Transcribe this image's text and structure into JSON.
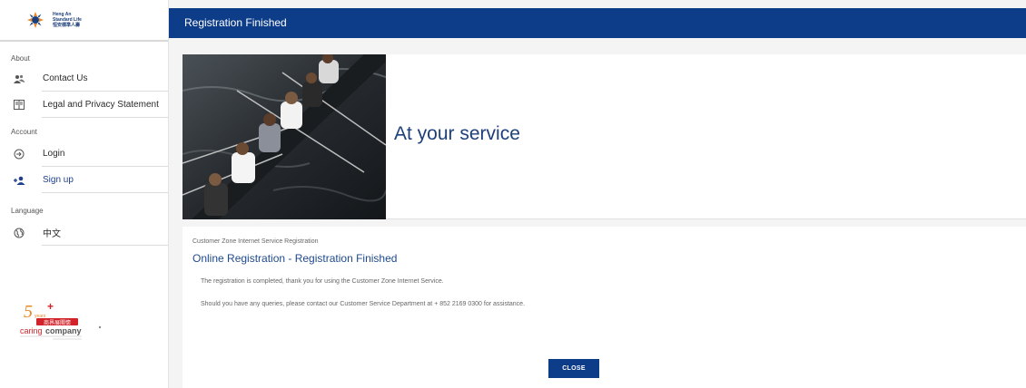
{
  "brand": {
    "line1": "Heng An",
    "line2": "Standard Life",
    "line3": "恒安標準人壽"
  },
  "sidebar": {
    "sections": [
      {
        "label": "About",
        "items": [
          {
            "label": "Contact Us",
            "icon": "people-icon"
          },
          {
            "label": "Legal and Privacy Statement",
            "icon": "document-icon"
          }
        ]
      },
      {
        "label": "Account",
        "items": [
          {
            "label": "Login",
            "icon": "login-icon"
          },
          {
            "label": "Sign up",
            "icon": "add-user-icon"
          }
        ]
      },
      {
        "label": "Language",
        "items": [
          {
            "label": "中文",
            "icon": "globe-icon"
          }
        ]
      }
    ],
    "badge": {
      "name": "caring-company-logo",
      "text_main": "caringcompany",
      "text_cn": "商界展關懷"
    }
  },
  "header": {
    "title": "Registration Finished"
  },
  "banner": {
    "tagline": "At your service"
  },
  "content": {
    "breadcrumb": "Customer Zone Internet Service Registration",
    "title": "Online Registration - Registration Finished",
    "message1": "The registration is completed, thank you for using the Customer Zone Internet Service.",
    "message2": "Should you have any queries, please contact our Customer Service Department at + 852 2169 0300 for assistance.",
    "close_label": "CLOSE"
  },
  "colors": {
    "primary": "#0d3c88",
    "accent_text": "#1e3f8c",
    "logo_orange": "#e8892b",
    "badge_red": "#d2232a"
  }
}
